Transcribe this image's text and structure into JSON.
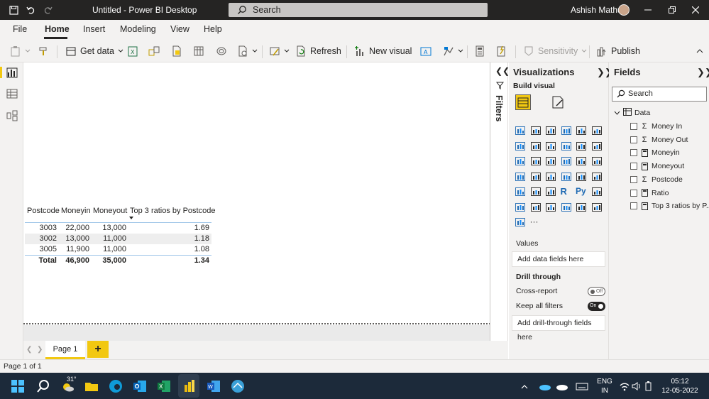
{
  "titlebar": {
    "title": "Untitled - Power BI Desktop",
    "search_placeholder": "Search",
    "user": "Ashish Mathur"
  },
  "menu": {
    "tabs": [
      "File",
      "Home",
      "Insert",
      "Modeling",
      "View",
      "Help"
    ],
    "active": "Home"
  },
  "ribbon": {
    "get_data": "Get data",
    "refresh": "Refresh",
    "new_visual": "New visual",
    "sensitivity": "Sensitivity",
    "publish": "Publish"
  },
  "table_visual": {
    "headers": [
      "Postcode",
      "Moneyin",
      "Moneyout",
      "Top 3 ratios by Postcode"
    ],
    "rows": [
      [
        "3003",
        "22,000",
        "13,000",
        "1.69"
      ],
      [
        "3002",
        "13,000",
        "11,000",
        "1.18"
      ],
      [
        "3005",
        "11,900",
        "11,000",
        "1.08"
      ]
    ],
    "total": [
      "Total",
      "46,900",
      "35,000",
      "1.34"
    ]
  },
  "pages": {
    "tabs": [
      "Page 1"
    ],
    "add_label": "+"
  },
  "filters": {
    "label": "Filters"
  },
  "visualizations": {
    "title": "Visualizations",
    "build_visual": "Build visual",
    "values_label": "Values",
    "values_placeholder": "Add data fields here",
    "drill_through": "Drill through",
    "cross_report": "Cross-report",
    "cross_report_state": "Off",
    "keep_all_filters": "Keep all filters",
    "keep_all_filters_state": "On",
    "drill_placeholder": "Add drill-through fields here",
    "more": "···"
  },
  "fields": {
    "title": "Fields",
    "search_placeholder": "Search",
    "table_name": "Data",
    "items": [
      {
        "label": "Money In",
        "icon": "sigma-icon"
      },
      {
        "label": "Money Out",
        "icon": "sigma-icon"
      },
      {
        "label": "Moneyin",
        "icon": "calculator-icon"
      },
      {
        "label": "Moneyout",
        "icon": "calculator-icon"
      },
      {
        "label": "Postcode",
        "icon": "sigma-icon"
      },
      {
        "label": "Ratio",
        "icon": "calculator-icon"
      },
      {
        "label": "Top 3 ratios by P...",
        "icon": "calculator-icon"
      }
    ]
  },
  "status": {
    "page_info": "Page 1 of 1"
  },
  "taskbar": {
    "temperature": "31°",
    "language": "ENG",
    "region": "IN",
    "time": "05:12",
    "date": "12-05-2022"
  },
  "colors": {
    "accent": "#f2c811",
    "titlebar": "#252423",
    "pane_bg": "#f3f2f1",
    "taskbar": "#1c2a3a"
  }
}
